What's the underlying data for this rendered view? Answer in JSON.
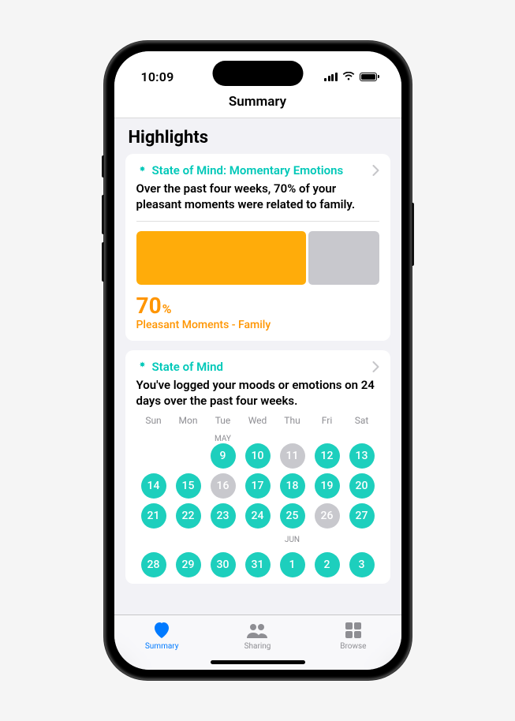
{
  "status": {
    "time": "10:09"
  },
  "nav": {
    "title": "Summary"
  },
  "section": {
    "title": "Highlights"
  },
  "card1": {
    "title": "State of Mind: Momentary Emotions",
    "desc": "Over the past four weeks, 70% of your pleasant moments were related to family.",
    "percent_value": "70",
    "percent_symbol": "%",
    "percent_label": "Pleasant Moments - Family",
    "fill_percent": 70
  },
  "card2": {
    "title": "State of Mind",
    "desc": "You've logged your moods or emotions on 24 days over the past four weeks.",
    "weekdays": [
      "Sun",
      "Mon",
      "Tue",
      "Wed",
      "Thu",
      "Fri",
      "Sat"
    ],
    "month1_label": "MAY",
    "month2_label": "JUN",
    "rows": [
      [
        {
          "n": "",
          "s": "empty"
        },
        {
          "n": "",
          "s": "empty"
        },
        {
          "n": "9",
          "s": "logged"
        },
        {
          "n": "10",
          "s": "logged"
        },
        {
          "n": "11",
          "s": "missed"
        },
        {
          "n": "12",
          "s": "logged"
        },
        {
          "n": "13",
          "s": "logged"
        }
      ],
      [
        {
          "n": "14",
          "s": "logged"
        },
        {
          "n": "15",
          "s": "logged"
        },
        {
          "n": "16",
          "s": "missed"
        },
        {
          "n": "17",
          "s": "logged"
        },
        {
          "n": "18",
          "s": "logged"
        },
        {
          "n": "19",
          "s": "logged"
        },
        {
          "n": "20",
          "s": "logged"
        }
      ],
      [
        {
          "n": "21",
          "s": "logged"
        },
        {
          "n": "22",
          "s": "logged"
        },
        {
          "n": "23",
          "s": "logged"
        },
        {
          "n": "24",
          "s": "logged"
        },
        {
          "n": "25",
          "s": "logged"
        },
        {
          "n": "26",
          "s": "missed"
        },
        {
          "n": "27",
          "s": "logged"
        }
      ]
    ],
    "peek_row": [
      {
        "n": "28",
        "s": "logged"
      },
      {
        "n": "29",
        "s": "logged"
      },
      {
        "n": "30",
        "s": "logged"
      },
      {
        "n": "31",
        "s": "logged"
      },
      {
        "n": "1",
        "s": "logged"
      },
      {
        "n": "2",
        "s": "logged"
      },
      {
        "n": "3",
        "s": "logged"
      }
    ]
  },
  "tabs": {
    "summary": "Summary",
    "sharing": "Sharing",
    "browse": "Browse"
  }
}
